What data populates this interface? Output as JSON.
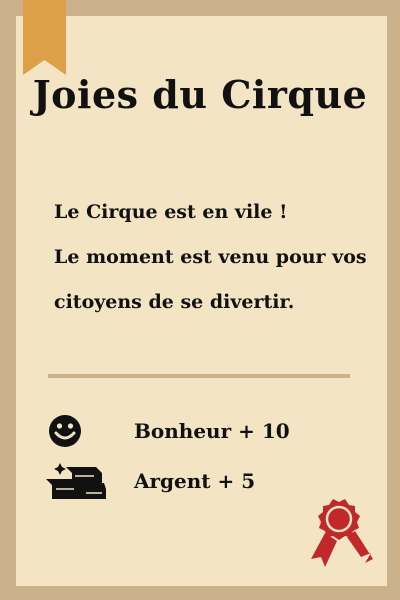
{
  "card": {
    "title": "Joies du Cirque",
    "body_lines": [
      "Le Cirque est en vile !",
      "Le moment est venu pour vos",
      "citoyens de se  divertir."
    ],
    "effects": [
      {
        "icon": "smiley-icon",
        "label": "Bonheur  + 10"
      },
      {
        "icon": "silver-bars-icon",
        "label": "Argent + 5"
      }
    ]
  },
  "colors": {
    "frame": "#cbb18c",
    "paper": "#f3e4c4",
    "bookmark": "#dd9f47",
    "seal": "#c0282a",
    "text": "#111111"
  }
}
